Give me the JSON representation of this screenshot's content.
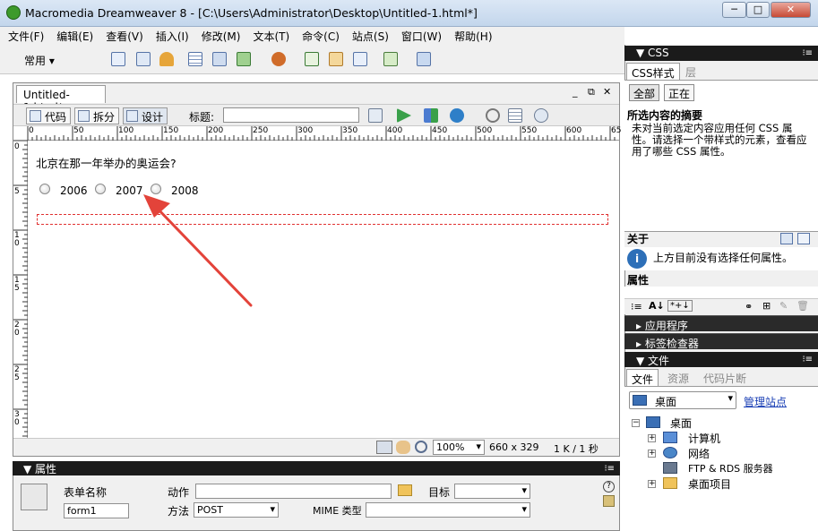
{
  "window": {
    "title": "Macromedia Dreamweaver 8 - [C:\\Users\\Administrator\\Desktop\\Untitled-1.html*]",
    "min": "─",
    "max": "□",
    "close": "✕"
  },
  "menu": [
    "文件(F)",
    "编辑(E)",
    "查看(V)",
    "插入(I)",
    "修改(M)",
    "文本(T)",
    "命令(C)",
    "站点(S)",
    "窗口(W)",
    "帮助(H)"
  ],
  "insert_bar": {
    "category": "常用"
  },
  "document": {
    "tab": "Untitled-1.html*",
    "win_controls": [
      "_",
      "⧉",
      "✕"
    ],
    "view_buttons": [
      "代码",
      "拆分",
      "设计"
    ],
    "title_label": "标题:",
    "title_value": "",
    "ruler_marks": [
      "0",
      "50",
      "100",
      "150",
      "200",
      "250",
      "300",
      "350",
      "400",
      "450",
      "500",
      "550",
      "600",
      "65"
    ],
    "vruler_marks": [
      "0",
      "5",
      "1 0",
      "1 5",
      "2 0",
      "2 5",
      "3 0"
    ],
    "question": "北京在那一年举办的奥运会?",
    "options": [
      "2006",
      "2007",
      "2008"
    ],
    "status": {
      "zoom": "100%",
      "size": "660 x 329",
      "weight": "1 K / 1 秒"
    }
  },
  "properties": {
    "header": "属性",
    "form_name_label": "表单名称",
    "form_name_value": "form1",
    "action_label": "动作",
    "action_value": "",
    "target_label": "目标",
    "target_value": "",
    "method_label": "方法",
    "method_value": "POST",
    "mime_label": "MIME 类型",
    "mime_value": ""
  },
  "css_panel": {
    "header": "CSS",
    "tabs": [
      "CSS样式",
      "层"
    ],
    "mode_buttons": [
      "全部",
      "正在"
    ],
    "summary_title": "所选内容的摘要",
    "summary_text": "未对当前选定内容应用任何 CSS 属性。请选择一个带样式的元素，查看应用了哪些 CSS 属性。",
    "about_title": "关于",
    "about_text": "上方目前没有选择任何属性。",
    "props_title": "属性"
  },
  "collapsed_panels": [
    "应用程序",
    "标签检查器"
  ],
  "files_panel": {
    "header": "文件",
    "tabs": [
      "文件",
      "资源",
      "代码片断"
    ],
    "location": "桌面",
    "manage_link": "管理站点",
    "root": "桌面",
    "items": [
      "计算机",
      "网络",
      "FTP & RDS 服务器",
      "桌面项目"
    ]
  }
}
